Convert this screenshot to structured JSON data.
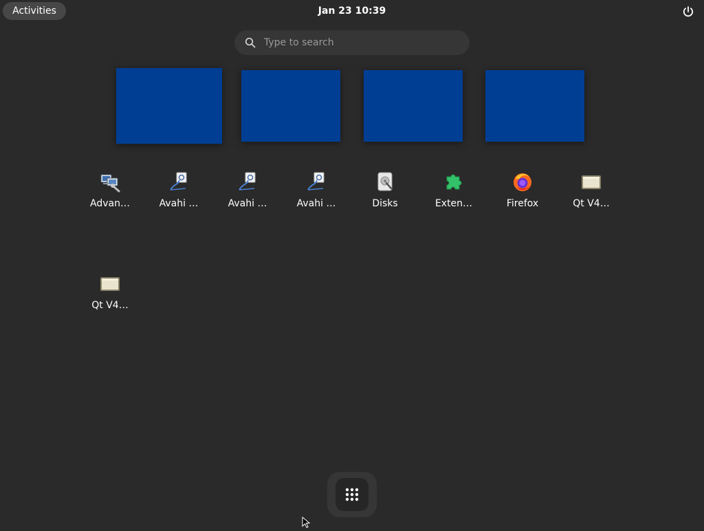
{
  "topbar": {
    "activities_label": "Activities",
    "clock_label": "Jan 23  10:39",
    "power_icon": "power-icon"
  },
  "search": {
    "placeholder": "Type to search",
    "icon": "search-icon"
  },
  "workspaces": {
    "color": "#003e94",
    "count": 4
  },
  "apps": [
    {
      "label": "Advan…",
      "icon": "network-settings-icon"
    },
    {
      "label": "Avahi …",
      "icon": "avahi-browser-icon"
    },
    {
      "label": "Avahi …",
      "icon": "avahi-browser-icon"
    },
    {
      "label": "Avahi …",
      "icon": "avahi-browser-icon"
    },
    {
      "label": "Disks",
      "icon": "disks-icon"
    },
    {
      "label": "Exten…",
      "icon": "extensions-icon"
    },
    {
      "label": "Firefox",
      "icon": "firefox-icon"
    },
    {
      "label": "Qt V4…",
      "icon": "qt-v4l2-icon"
    },
    {
      "label": "Qt V4…",
      "icon": "qt-v4l2-icon"
    }
  ],
  "dash": {
    "show_apps_icon": "app-grid-icon"
  }
}
